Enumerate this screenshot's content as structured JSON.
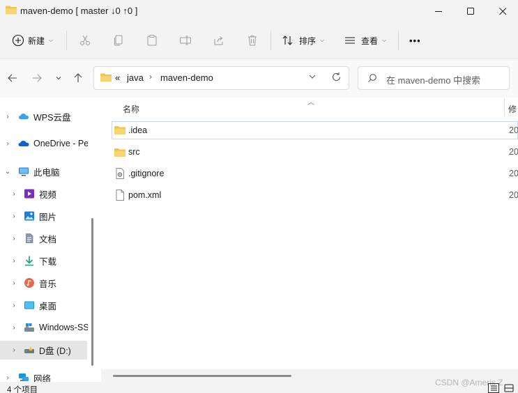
{
  "window": {
    "title": "maven-demo [ master ↓0 ↑0 ]"
  },
  "toolbar": {
    "new_label": "新建",
    "sort_label": "排序",
    "view_label": "查看",
    "more_label": "•••"
  },
  "nav": {
    "breadcrumb_overflow": "«",
    "breadcrumbs": [
      "java",
      "maven-demo"
    ],
    "search_placeholder": "在 maven-demo 中搜索"
  },
  "sidebar": {
    "items": [
      {
        "label": "WPS云盘",
        "icon": "cloud-icon"
      },
      {
        "label": "OneDrive - Pe",
        "icon": "onedrive-icon"
      },
      {
        "label": "此电脑",
        "icon": "computer-icon"
      },
      {
        "label": "视频",
        "icon": "video-icon"
      },
      {
        "label": "图片",
        "icon": "pictures-icon"
      },
      {
        "label": "文档",
        "icon": "documents-icon"
      },
      {
        "label": "下载",
        "icon": "download-icon"
      },
      {
        "label": "音乐",
        "icon": "music-icon"
      },
      {
        "label": "桌面",
        "icon": "desktop-icon"
      },
      {
        "label": "Windows-SS",
        "icon": "windows-drive-icon"
      },
      {
        "label": "D盘 (D:)",
        "icon": "drive-icon"
      },
      {
        "label": "网络",
        "icon": "network-icon"
      }
    ]
  },
  "files": {
    "col_name": "名称",
    "col_modified": "修",
    "rows": [
      {
        "name": ".idea",
        "date": "20"
      },
      {
        "name": "src",
        "date": "20"
      },
      {
        "name": ".gitignore",
        "date": "20"
      },
      {
        "name": "pom.xml",
        "date": "20"
      }
    ]
  },
  "status": {
    "item_count": "4 个项目"
  },
  "watermark": "CSDN @Ameris Z",
  "colors": {
    "folder": "#f2c14e",
    "selection_border": "#c9d8ec",
    "chrome_bg": "#f3f3f3"
  }
}
